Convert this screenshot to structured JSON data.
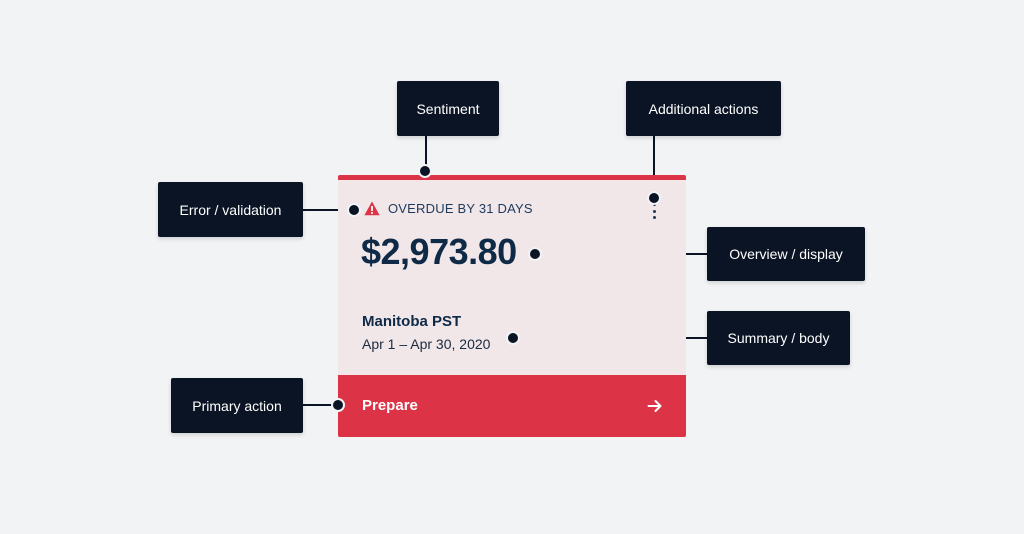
{
  "card": {
    "status": "OVERDUE BY 31 DAYS",
    "amount": "$2,973.80",
    "summary_title": "Manitoba PST",
    "summary_period": "Apr 1 – Apr 30, 2020",
    "primary_action": "Prepare",
    "icons": {
      "status": "warning-icon",
      "more": "kebab-menu-icon",
      "action": "arrow-right-icon"
    }
  },
  "annotations": {
    "sentiment": "Sentiment",
    "additional_actions": "Additional actions",
    "error_validation": "Error / validation",
    "overview_display": "Overview / display",
    "summary_body": "Summary / body",
    "primary_action": "Primary action"
  },
  "colors": {
    "background": "#f2f3f5",
    "card_background": "#f1e6e8",
    "accent_red": "#dc3446",
    "text_navy": "#0f2a47",
    "callout_dark": "#0b1424"
  }
}
